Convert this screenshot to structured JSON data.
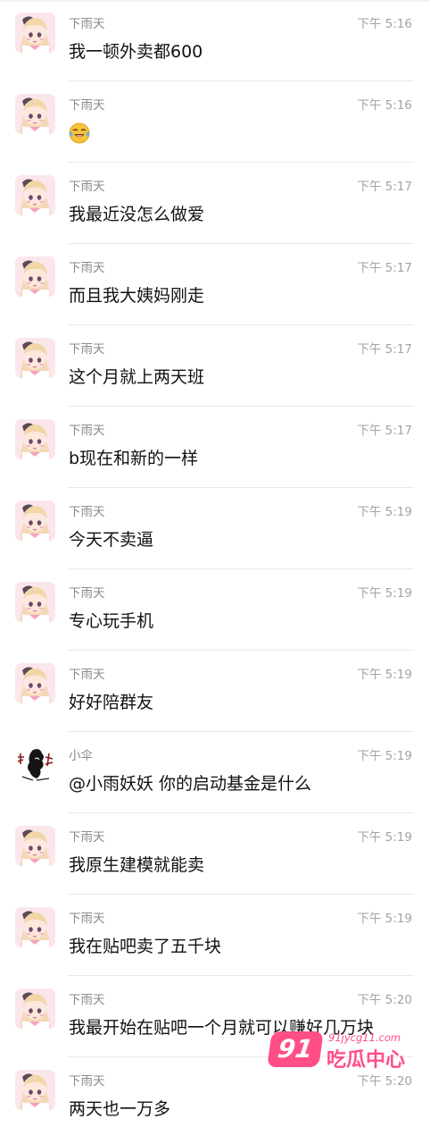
{
  "messages": [
    {
      "sender": "下雨天",
      "time": "下午 5:16",
      "text": "我一顿外卖都600",
      "avatar": "anime-girl"
    },
    {
      "sender": "下雨天",
      "time": "下午 5:16",
      "text": "",
      "emoji": "crying-laughing-emoji",
      "avatar": "anime-girl"
    },
    {
      "sender": "下雨天",
      "time": "下午 5:17",
      "text": "我最近没怎么做爱",
      "avatar": "anime-girl"
    },
    {
      "sender": "下雨天",
      "time": "下午 5:17",
      "text": "而且我大姨妈刚走",
      "avatar": "anime-girl"
    },
    {
      "sender": "下雨天",
      "time": "下午 5:17",
      "text": "这个月就上两天班",
      "avatar": "anime-girl"
    },
    {
      "sender": "下雨天",
      "time": "下午 5:17",
      "text": "b现在和新的一样",
      "avatar": "anime-girl"
    },
    {
      "sender": "下雨天",
      "time": "下午 5:19",
      "text": "今天不卖逼",
      "avatar": "anime-girl"
    },
    {
      "sender": "下雨天",
      "time": "下午 5:19",
      "text": "专心玩手机",
      "avatar": "anime-girl"
    },
    {
      "sender": "下雨天",
      "time": "下午 5:19",
      "text": "好好陪群友",
      "avatar": "anime-girl"
    },
    {
      "sender": "小伞",
      "time": "下午 5:19",
      "text": "@小雨妖妖 你的启动基金是什么",
      "avatar": "ink-calligraphy"
    },
    {
      "sender": "下雨天",
      "time": "下午 5:19",
      "text": "我原生建模就能卖",
      "avatar": "anime-girl"
    },
    {
      "sender": "下雨天",
      "time": "下午 5:19",
      "text": "我在贴吧卖了五千块",
      "avatar": "anime-girl"
    },
    {
      "sender": "下雨天",
      "time": "下午 5:20",
      "text": "我最开始在贴吧一个月就可以赚好几万块",
      "avatar": "anime-girl"
    },
    {
      "sender": "下雨天",
      "time": "下午 5:20",
      "text": "两天也一万多",
      "avatar": "anime-girl"
    }
  ],
  "watermark": {
    "badge": "91",
    "url": "91jycg11.com",
    "name": "吃瓜中心",
    "color": "#ff4f86"
  },
  "colors": {
    "sender": "#8a8a8a",
    "time": "#a3a3a3",
    "text": "#111111",
    "divider": "#e9e9e9"
  }
}
